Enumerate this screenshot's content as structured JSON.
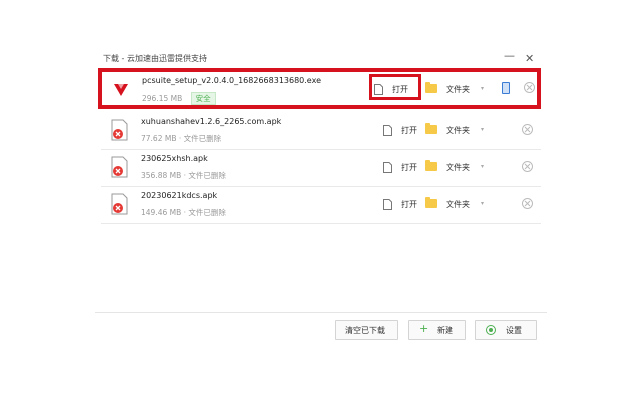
{
  "window": {
    "title": "下载 - 云加速由迅雷提供支持",
    "minimize_glyph": "—",
    "close_glyph": "✕"
  },
  "downloads": [
    {
      "name": "pcsuite_setup_v2.0.4.0_1682668313680.exe",
      "size": "296.15 MB",
      "status": "",
      "badge": "安全",
      "icon": "app-logo-icon"
    },
    {
      "name": "xuhuanshahev1.2.6_2265.com.apk",
      "size": "77.62 MB",
      "status": "· 文件已删除",
      "badge": "",
      "icon": "deleted-file-icon"
    },
    {
      "name": "230625xhsh.apk",
      "size": "356.88 MB",
      "status": "· 文件已删除",
      "badge": "",
      "icon": "deleted-file-icon"
    },
    {
      "name": "20230621kdcs.apk",
      "size": "149.46 MB",
      "status": "· 文件已删除",
      "badge": "",
      "icon": "deleted-file-icon"
    }
  ],
  "actions": {
    "open": "打开",
    "folder": "文件夹"
  },
  "footer": {
    "clear": "清空已下载",
    "new": "新建",
    "settings": "设置"
  },
  "colors": {
    "highlight": "#d6121e",
    "accent": "#4caf50",
    "folder": "#f7c948"
  }
}
